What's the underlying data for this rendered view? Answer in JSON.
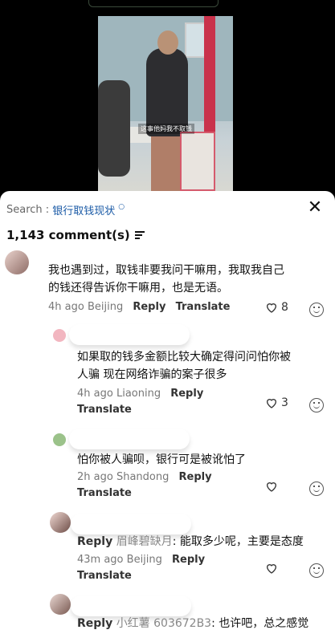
{
  "video": {
    "caption": "这事他妈我不取钱"
  },
  "search": {
    "label": "Search : ",
    "query": "银行取钱现状",
    "close": "✕"
  },
  "comments_header": {
    "count": "1,143 comment(s)"
  },
  "comments": [
    {
      "text_line1": "我也遇到过，取钱非要我问干嘛用，我取我自己",
      "text_line2": "的钱还得告诉你干嘛用，也是无语。",
      "time": "4h ago",
      "location": "Beijing",
      "reply": "Reply",
      "translate": "Translate",
      "likes": "8"
    },
    {
      "text_line1": "如果取的钱多金额比较大确定得问问怕你被",
      "text_line2": "人骗 现在网络诈骗的案子很多",
      "time": "4h ago",
      "location": "Liaoning",
      "reply": "Reply",
      "translate": "Translate",
      "likes": "3"
    },
    {
      "text_line1": "怕你被人骗呗，银行可是被讹怕了",
      "time": "2h ago",
      "location": "Shandong",
      "reply": "Reply",
      "translate": "Translate"
    },
    {
      "reply_word": "Reply",
      "reply_to": "眉峰碧缺月",
      "text": ": 能取多少呢，主要是态度",
      "time": "43m ago",
      "location": "Beijing",
      "reply": "Reply",
      "translate": "Translate"
    },
    {
      "reply_word": "Reply",
      "reply_to": "小红薯 603672B3",
      "text": ": 也许吧，总之感觉"
    }
  ]
}
